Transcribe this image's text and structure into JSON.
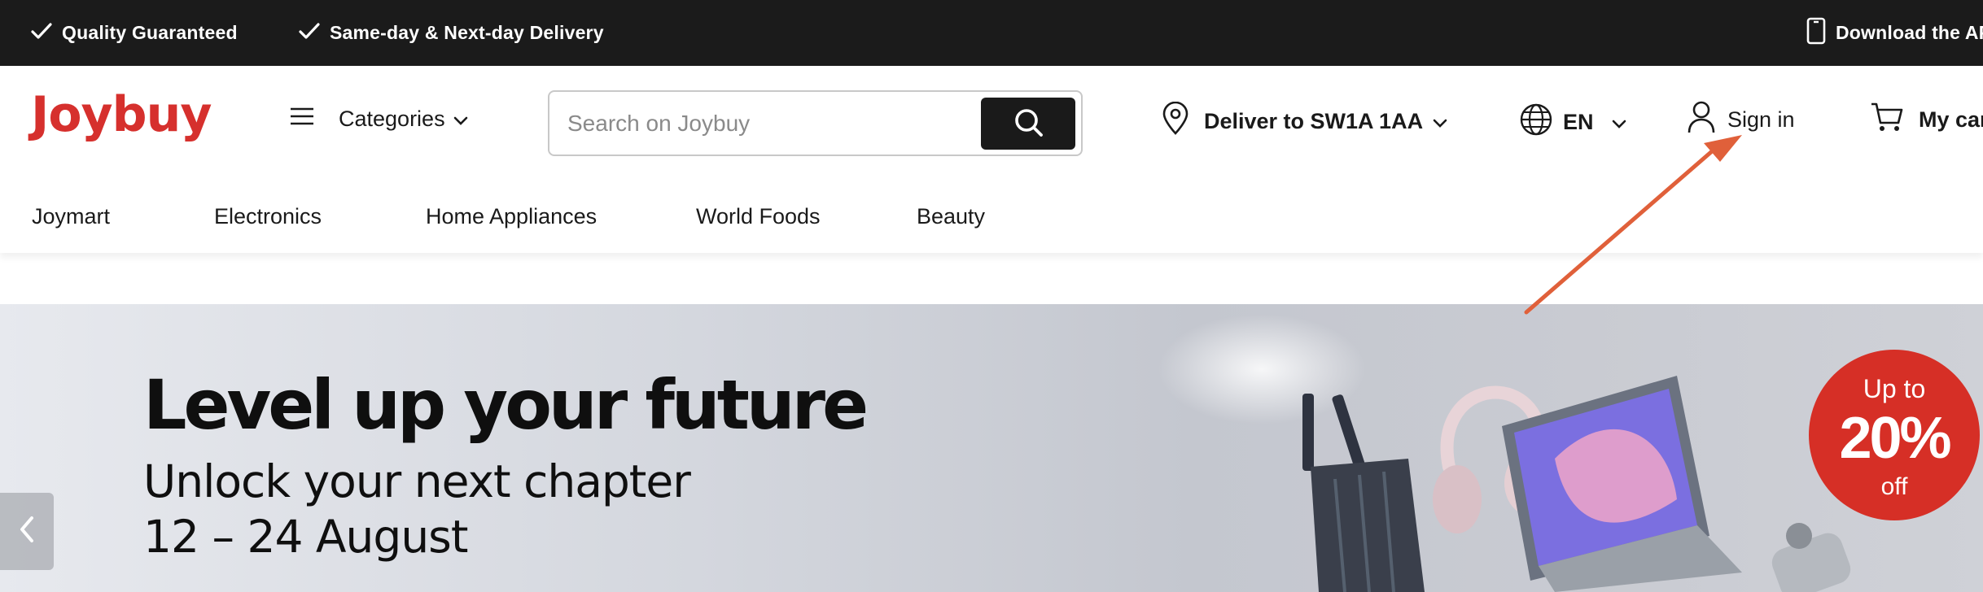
{
  "topbar": {
    "quality": "Quality Guaranteed",
    "delivery": "Same-day & Next-day Delivery",
    "app": "Download the APP"
  },
  "header": {
    "logo": "Joybuy",
    "categories_label": "Categories",
    "search_placeholder": "Search on Joybuy",
    "deliver_label": "Deliver to SW1A 1AA",
    "language": "EN",
    "signin_label": "Sign in",
    "cart_label": "My cart"
  },
  "nav": {
    "items": [
      "Joymart",
      "Electronics",
      "Home Appliances",
      "World Foods",
      "Beauty"
    ]
  },
  "banner": {
    "headline": "Level up your future",
    "subline": "Unlock your next chapter",
    "dates": "12 – 24 August",
    "badge_top": "Up to",
    "badge_value": "20%",
    "badge_bottom": "off"
  },
  "colors": {
    "brand_red": "#d6302d",
    "topbar_bg": "#1b1b1b",
    "annotation_arrow": "#e0603a"
  },
  "icons": [
    "check-icon",
    "phone-icon",
    "menu-icon",
    "chevron-down-icon",
    "search-icon",
    "location-pin-icon",
    "globe-icon",
    "user-icon",
    "cart-icon",
    "chevron-left-icon",
    "annotation-arrow"
  ]
}
